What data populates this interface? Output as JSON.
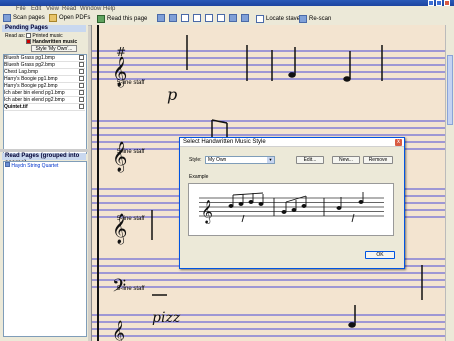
{
  "menu": [
    "File",
    "Edit",
    "View",
    "Read",
    "Window",
    "Help"
  ],
  "toolbar": {
    "scan_pages": "Scan pages",
    "open_pdfs": "Open PDFs"
  },
  "score_toolbar": {
    "read_this_page": "Read this page",
    "locate_staves": "Locate staves",
    "rescan": "Re-scan"
  },
  "pending": {
    "header": "Pending Pages",
    "read_as": "Read as:",
    "printed_music": "Printed music",
    "handwritten_music": "Handwritten music",
    "style_button": "Style 'My Own'...",
    "files": [
      "Bluesh Grass pg1.bmp",
      "Bluesh Grass pg2.bmp",
      "Chest Lag.bmp",
      "Harry's Boogie pg1.bmp",
      "Harry's Boogie pg2.bmp",
      "Ich aber bin elend pg1.bmp",
      "Ich aber bin elend pg2.bmp",
      "Quintet.tif"
    ]
  },
  "read_pages": {
    "header": "Read Pages (grouped into scores)",
    "items": [
      "Haydn String Quartet"
    ]
  },
  "score": {
    "staff_label": "5-line staff",
    "staff_count": 5
  },
  "dialog": {
    "title": "Select Handwritten Music Style",
    "style_label": "Style:",
    "style_value": "My Own",
    "edit_label": "Edit...",
    "new_label": "New...",
    "remove_label": "Remove",
    "example_label": "Example",
    "ok_label": "OK",
    "close_glyph": "x"
  },
  "colors": {
    "staff_lines": "#4a4ad8",
    "paper": "#f3e4d0",
    "titlebar": "#2a5ab8",
    "accent_red": "#cc0000"
  }
}
